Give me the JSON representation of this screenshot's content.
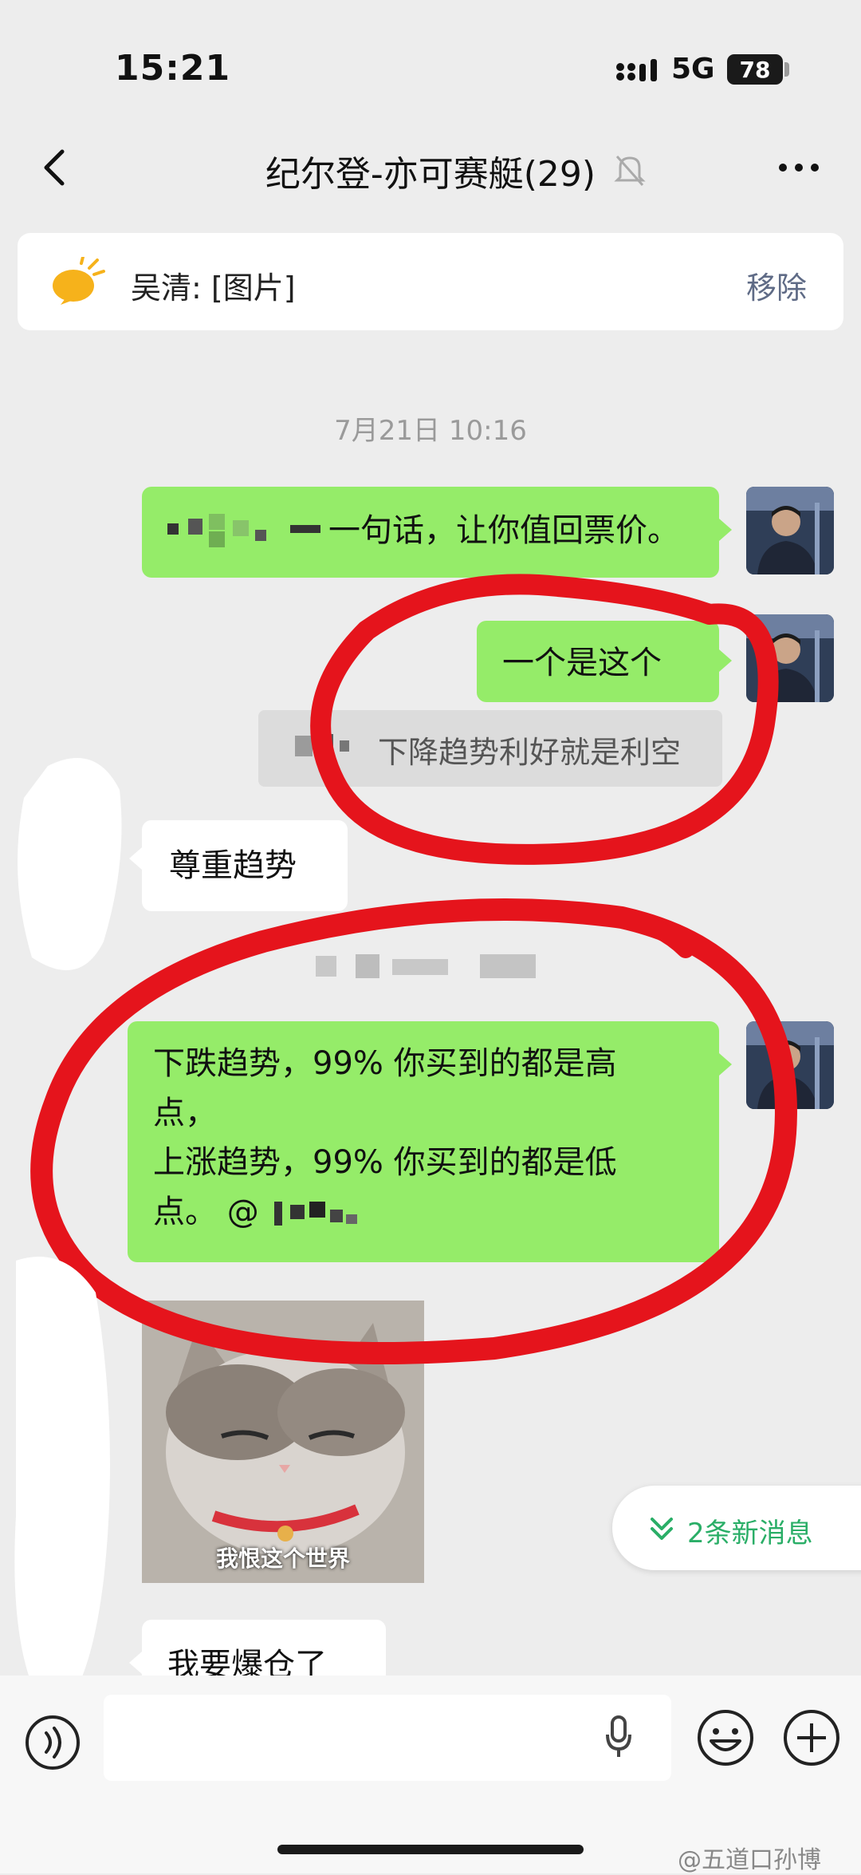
{
  "status_bar": {
    "time": "15:21",
    "network": "5G",
    "battery": "78"
  },
  "nav": {
    "title": "纪尔登-亦可赛艇(29)",
    "back_icon": "chevron-left-icon",
    "mute_icon": "bell-muted-icon",
    "more_icon": "more-dots-icon"
  },
  "pinned": {
    "text": "吴清: [图片]",
    "remove_label": "移除",
    "icon": "announcement-icon"
  },
  "chat": {
    "timestamp": "7月21日 10:16",
    "messages": [
      {
        "side": "right",
        "type": "text",
        "text": "一句话，让你值回票价。"
      },
      {
        "side": "right",
        "type": "text",
        "text": "一个是这个",
        "quote": "下降趋势利好就是利空"
      },
      {
        "side": "left",
        "type": "text",
        "text": "尊重趋势"
      },
      {
        "side": "right",
        "type": "text",
        "lines": [
          "下跌趋势，99% 你买到的都是高",
          "点，",
          "上涨趋势，99% 你买到的都是低",
          "点。 @"
        ]
      },
      {
        "side": "left",
        "type": "image",
        "caption": "我恨这个世界"
      },
      {
        "side": "left",
        "type": "text",
        "text": "我要爆仓了"
      }
    ]
  },
  "new_messages": {
    "label": "2条新消息",
    "icon": "double-chevron-down-icon"
  },
  "input_bar": {
    "voice_icon": "voice-icon",
    "mic_icon": "microphone-icon",
    "emoji_icon": "emoji-icon",
    "plus_icon": "plus-icon"
  },
  "watermark": "@五道口孙博",
  "colors": {
    "background": "#ededed",
    "bubble_green": "#95ec69",
    "bubble_white": "#ffffff",
    "annotation_red": "#e5141c",
    "accent_green": "#2aae67"
  }
}
